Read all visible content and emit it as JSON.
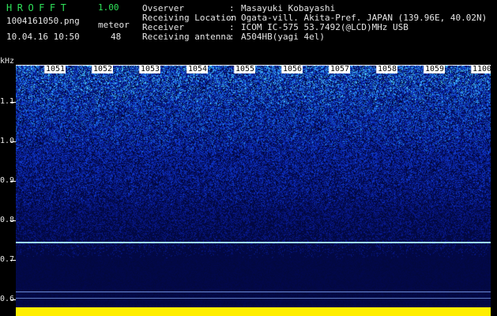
{
  "app": {
    "name": "HROFFT",
    "version": "1.00"
  },
  "file": {
    "name": "1004161050.png",
    "datetime": "10.04.16 10:50"
  },
  "meteor": {
    "label": "meteor",
    "count": "48"
  },
  "info": [
    {
      "label": "Ovserver",
      "value": "Masayuki Kobayashi"
    },
    {
      "label": "Receiving Location",
      "value": "Ogata-vill. Akita-Pref. JAPAN (139.96E, 40.02N)"
    },
    {
      "label": "Receiver",
      "value": "ICOM IC-575 53.7492(@LCD)MHz USB"
    },
    {
      "label": "Receiving antenna",
      "value": "A504HB(yagi 4el)"
    }
  ],
  "time_axis": {
    "labels": [
      "1051",
      "1052",
      "1053",
      "1054",
      "1055",
      "1056",
      "1057",
      "1058",
      "1059",
      "1100"
    ]
  },
  "freq_axis": {
    "unit": "kHz",
    "labels": [
      "1.1",
      "1.0",
      "0.9",
      "0.8",
      "0.7",
      "0.6"
    ]
  },
  "colors": {
    "title_green": "#2fe35a",
    "background": "#000000",
    "noise_low": "#020a3c",
    "noise_high": "#44ccff",
    "carrier": "#9fe8ff",
    "meteor_bar": "#ffee00"
  }
}
